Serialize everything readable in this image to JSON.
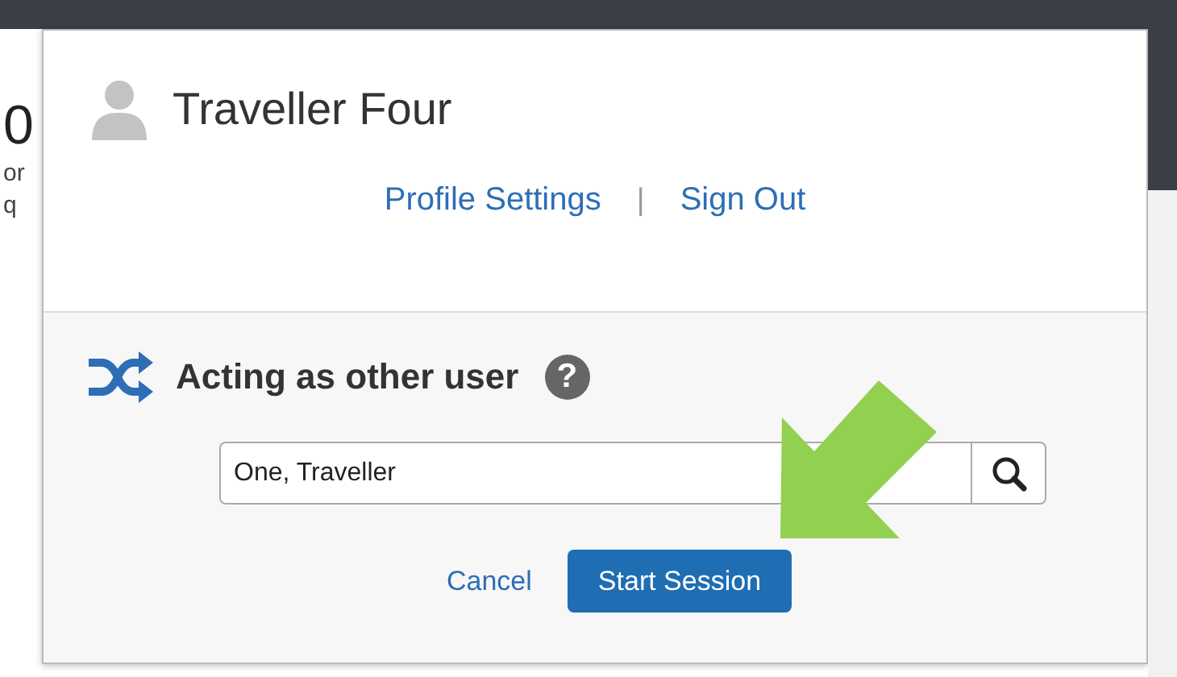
{
  "background": {
    "fragments": [
      "0",
      "or",
      "q"
    ]
  },
  "profile": {
    "name": "Traveller Four",
    "links": [
      {
        "label": "Profile Settings"
      },
      {
        "label": "Sign Out"
      }
    ],
    "separator": "|"
  },
  "act_as": {
    "title": "Acting as other user",
    "help": "?"
  },
  "search": {
    "value": "One, Traveller"
  },
  "buttons": [
    {
      "label": "Cancel",
      "kind": "link"
    },
    {
      "label": "Start Session",
      "kind": "primary"
    }
  ]
}
